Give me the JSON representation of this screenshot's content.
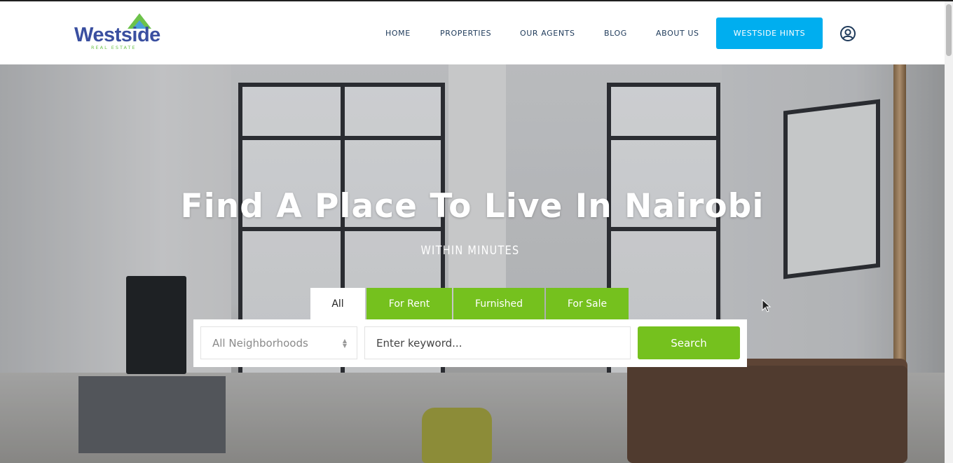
{
  "logo": {
    "name": "Westside",
    "tagline": "REAL ESTATE"
  },
  "nav": {
    "items": [
      "HOME",
      "PROPERTIES",
      "OUR AGENTS",
      "BLOG",
      "ABOUT US"
    ],
    "cta": "WESTSIDE HINTS",
    "account_icon": "user-circle-icon"
  },
  "hero": {
    "title": "Find A Place To Live In Nairobi",
    "subtitle": "WITHIN MINUTES"
  },
  "search": {
    "tabs": [
      "All",
      "For Rent",
      "Furnished",
      "For Sale"
    ],
    "active_tab": "All",
    "neighborhood_select": "All Neighborhoods",
    "keyword_placeholder": "Enter keyword...",
    "button": "Search"
  },
  "colors": {
    "accent_green": "#75c11e",
    "cta_blue": "#00aeef",
    "nav_text": "#1e3a5a",
    "logo_blue": "#3a4fa0"
  }
}
